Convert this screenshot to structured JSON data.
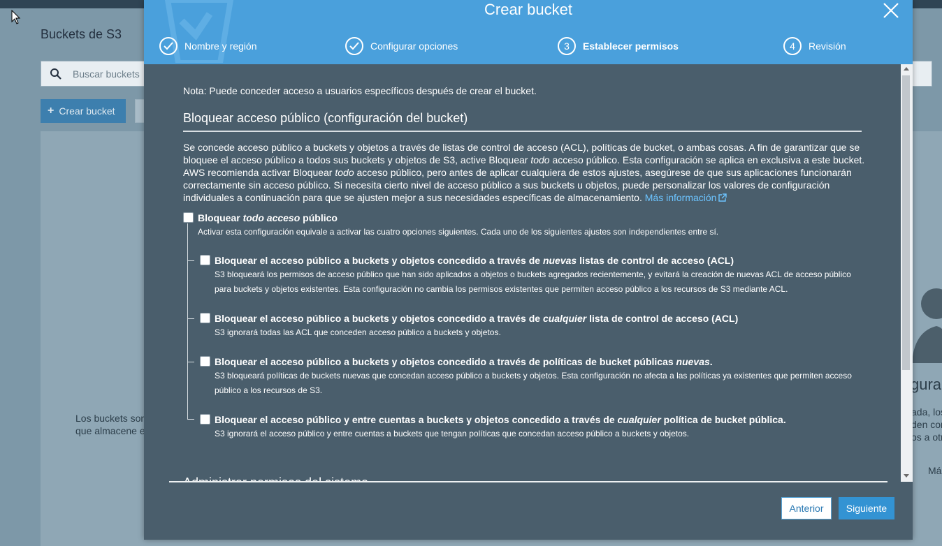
{
  "background": {
    "page_title": "Buckets de S3",
    "search_placeholder": "Buscar buckets",
    "create_button": "Crear bucket",
    "empty_text_line1": "Los buckets son",
    "empty_text_line2": "que almacene e",
    "right_heading": "figura",
    "right_line1": "ada, los",
    "right_line2": "den con",
    "right_line3": "os a otr",
    "right_more": "Más"
  },
  "modal": {
    "title": "Crear bucket",
    "steps": [
      {
        "label": "Nombre y región",
        "state": "done"
      },
      {
        "label": "Configurar opciones",
        "state": "done"
      },
      {
        "number": "3",
        "label": "Establecer permisos",
        "state": "active"
      },
      {
        "number": "4",
        "label": "Revisión",
        "state": "pending"
      }
    ],
    "note": "Nota: Puede conceder acceso a usuarios específicos después de crear el bucket.",
    "section_title": "Bloquear acceso público (configuración del bucket)",
    "description": {
      "part1": "Se concede acceso público a buckets y objetos a través de listas de control de acceso (ACL), políticas de bucket, o ambas cosas. A fin de garantizar que se bloquee el acceso público a todos sus buckets y objetos de S3, active Bloquear ",
      "em1": "todo",
      "part2": " acceso público. Esta configuración se aplica en exclusiva a este bucket. AWS recomienda activar Bloquear ",
      "em2": "todo",
      "part3": " acceso público, pero antes de aplicar cualquiera de estos ajustes, asegúrese de que sus aplicaciones funcionarán correctamente sin acceso público. Si necesita cierto nivel de acceso público a sus buckets u objetos, puede personalizar los valores de configuración individuales a continuación para que se ajusten mejor a sus necesidades específicas de almacenamiento.",
      "link": "Más información"
    },
    "block_all": {
      "pre": "Bloquear ",
      "em": "todo acceso",
      "post": " público",
      "desc": "Activar esta configuración equivale a activar las cuatro opciones siguientes. Cada uno de los siguientes ajustes son independientes entre sí.",
      "checked": false
    },
    "options": [
      {
        "pre": "Bloquear el acceso público a buckets y objetos concedido a través de ",
        "em": "nuevas",
        "post": " listas de control de acceso (ACL)",
        "desc": "S3 bloqueará los permisos de acceso público que han sido aplicados a objetos o buckets agregados recientemente, y evitará la creación de nuevas ACL de acceso público para buckets y objetos existentes. Esta configuración no cambia los permisos existentes que permiten acceso público a los recursos de S3 mediante ACL.",
        "checked": false
      },
      {
        "pre": "Bloquear el acceso público a buckets y objetos concedido a través de ",
        "em": "cualquier",
        "post": " lista de control de acceso (ACL)",
        "desc": "S3 ignorará todas las ACL que conceden acceso público a buckets y objetos.",
        "checked": false
      },
      {
        "pre": "Bloquear el acceso público a buckets y objetos concedido a través de políticas de bucket públicas ",
        "em": "nuevas",
        "post": ".",
        "desc": "S3 bloqueará políticas de buckets nuevas que concedan acceso público a buckets y objetos. Esta configuración no afecta a las políticas ya existentes que permiten acceso público a los recursos de S3.",
        "checked": false
      },
      {
        "pre": "Bloquear el acceso público y entre cuentas a buckets y objetos concedido a través de ",
        "em": "cualquier",
        "post": " política de bucket pública.",
        "desc": "S3 ignorará el acceso público y entre cuentas a buckets que tengan políticas que concedan acceso público a buckets y objetos.",
        "checked": false
      }
    ],
    "next_section_title": "Administrar permisos del sistema",
    "buttons": {
      "previous": "Anterior",
      "next": "Siguiente"
    }
  },
  "colors": {
    "header": "#4aa0dc",
    "modal_body": "#4a5e6c",
    "link": "#6cc4ff",
    "primary_button": "#3393d3"
  }
}
